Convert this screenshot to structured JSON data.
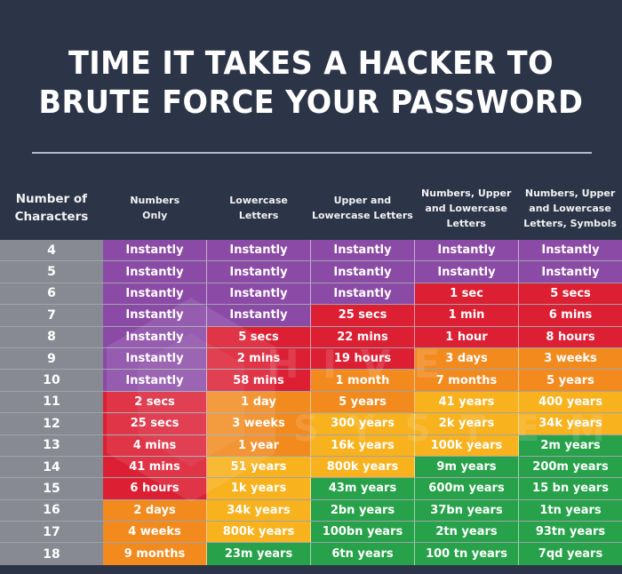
{
  "title": {
    "line1": "TIME IT TAKES A HACKER TO",
    "line2": "BRUTE FORCE YOUR PASSWORD"
  },
  "watermark": {
    "line1": "HIVE",
    "line2": "SYSTEMS"
  },
  "colors": {
    "background": "#2c3448",
    "rule": "#aeb8d0",
    "char_column": "#878a93",
    "instantly": "#8b4aa6",
    "seconds_to_hours": "#dc1f33",
    "days_to_months": "#f28a1e",
    "years": "#f8b21e",
    "millions_plus": "#27a24a"
  },
  "chart_data": {
    "type": "table",
    "title": "TIME IT TAKES A HACKER TO BRUTE FORCE YOUR PASSWORD",
    "row_header": "Number of Characters",
    "columns": [
      "Numbers Only",
      "Lowercase Letters",
      "Upper and Lowercase Letters",
      "Numbers, Upper and Lowercase Letters",
      "Numbers, Upper and Lowercase Letters, Symbols"
    ],
    "rows": [
      {
        "chars": "4",
        "values": [
          "Instantly",
          "Instantly",
          "Instantly",
          "Instantly",
          "Instantly"
        ],
        "levels": [
          "instantly",
          "instantly",
          "instantly",
          "instantly",
          "instantly"
        ]
      },
      {
        "chars": "5",
        "values": [
          "Instantly",
          "Instantly",
          "Instantly",
          "Instantly",
          "Instantly"
        ],
        "levels": [
          "instantly",
          "instantly",
          "instantly",
          "instantly",
          "instantly"
        ]
      },
      {
        "chars": "6",
        "values": [
          "Instantly",
          "Instantly",
          "Instantly",
          "1 sec",
          "5 secs"
        ],
        "levels": [
          "instantly",
          "instantly",
          "instantly",
          "seconds_to_hours",
          "seconds_to_hours"
        ]
      },
      {
        "chars": "7",
        "values": [
          "Instantly",
          "Instantly",
          "25 secs",
          "1 min",
          "6 mins"
        ],
        "levels": [
          "instantly",
          "instantly",
          "seconds_to_hours",
          "seconds_to_hours",
          "seconds_to_hours"
        ]
      },
      {
        "chars": "8",
        "values": [
          "Instantly",
          "5 secs",
          "22 mins",
          "1 hour",
          "8 hours"
        ],
        "levels": [
          "instantly",
          "seconds_to_hours",
          "seconds_to_hours",
          "seconds_to_hours",
          "seconds_to_hours"
        ]
      },
      {
        "chars": "9",
        "values": [
          "Instantly",
          "2 mins",
          "19 hours",
          "3 days",
          "3 weeks"
        ],
        "levels": [
          "instantly",
          "seconds_to_hours",
          "seconds_to_hours",
          "days_to_months",
          "days_to_months"
        ]
      },
      {
        "chars": "10",
        "values": [
          "Instantly",
          "58 mins",
          "1 month",
          "7 months",
          "5 years"
        ],
        "levels": [
          "instantly",
          "seconds_to_hours",
          "days_to_months",
          "days_to_months",
          "days_to_months"
        ]
      },
      {
        "chars": "11",
        "values": [
          "2 secs",
          "1 day",
          "5 years",
          "41 years",
          "400 years"
        ],
        "levels": [
          "seconds_to_hours",
          "days_to_months",
          "days_to_months",
          "years",
          "years"
        ]
      },
      {
        "chars": "12",
        "values": [
          "25 secs",
          "3 weeks",
          "300 years",
          "2k years",
          "34k years"
        ],
        "levels": [
          "seconds_to_hours",
          "days_to_months",
          "years",
          "years",
          "years"
        ]
      },
      {
        "chars": "13",
        "values": [
          "4 mins",
          "1 year",
          "16k years",
          "100k years",
          "2m years"
        ],
        "levels": [
          "seconds_to_hours",
          "days_to_months",
          "years",
          "years",
          "millions_plus"
        ]
      },
      {
        "chars": "14",
        "values": [
          "41 mins",
          "51 years",
          "800k years",
          "9m years",
          "200m years"
        ],
        "levels": [
          "seconds_to_hours",
          "years",
          "years",
          "millions_plus",
          "millions_plus"
        ]
      },
      {
        "chars": "15",
        "values": [
          "6 hours",
          "1k years",
          "43m years",
          "600m years",
          "15 bn years"
        ],
        "levels": [
          "seconds_to_hours",
          "years",
          "millions_plus",
          "millions_plus",
          "millions_plus"
        ]
      },
      {
        "chars": "16",
        "values": [
          "2 days",
          "34k years",
          "2bn years",
          "37bn years",
          "1tn years"
        ],
        "levels": [
          "days_to_months",
          "years",
          "millions_plus",
          "millions_plus",
          "millions_plus"
        ]
      },
      {
        "chars": "17",
        "values": [
          "4 weeks",
          "800k years",
          "100bn years",
          "2tn years",
          "93tn years"
        ],
        "levels": [
          "days_to_months",
          "years",
          "millions_plus",
          "millions_plus",
          "millions_plus"
        ]
      },
      {
        "chars": "18",
        "values": [
          "9 months",
          "23m years",
          "6tn years",
          "100 tn years",
          "7qd years"
        ],
        "levels": [
          "days_to_months",
          "millions_plus",
          "millions_plus",
          "millions_plus",
          "millions_plus"
        ]
      }
    ]
  },
  "header": {
    "first": [
      "Number of",
      "Characters"
    ],
    "columns": [
      [
        "Numbers",
        "Only"
      ],
      [
        "Lowercase",
        "Letters"
      ],
      [
        "Upper and",
        "Lowercase Letters"
      ],
      [
        "Numbers, Upper",
        "and Lowercase",
        "Letters"
      ],
      [
        "Numbers, Upper",
        "and Lowercase",
        "Letters, Symbols"
      ]
    ]
  }
}
